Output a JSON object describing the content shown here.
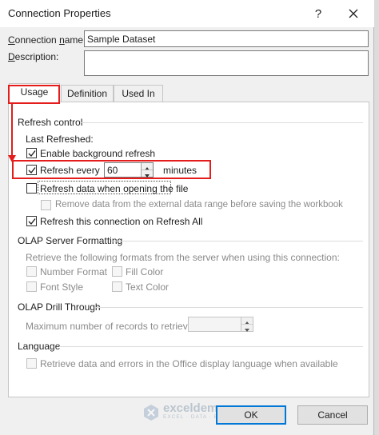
{
  "window": {
    "title": "Connection Properties"
  },
  "connection": {
    "name_label": "Connection name:",
    "name_value": "Sample Dataset",
    "description_label": "Description:",
    "description_value": ""
  },
  "tabs": [
    {
      "label": "Usage"
    },
    {
      "label": "Definition"
    },
    {
      "label": "Used In"
    }
  ],
  "refresh_control": {
    "heading": "Refresh control",
    "last_refreshed_label": "Last Refreshed:",
    "enable_background": {
      "label": "Enable background refresh",
      "checked": true
    },
    "refresh_every": {
      "label": "Refresh every",
      "value": "60",
      "unit": "minutes",
      "checked": true
    },
    "refresh_on_open": {
      "label": "Refresh data when opening the file",
      "checked": false
    },
    "remove_data": {
      "label": "Remove data from the external data range before saving the workbook",
      "checked": false
    },
    "refresh_all": {
      "label": "Refresh this connection on Refresh All",
      "checked": true
    }
  },
  "olap_formatting": {
    "heading": "OLAP Server Formatting",
    "description": "Retrieve the following formats from the server when using this connection:",
    "number_format": "Number Format",
    "fill_color": "Fill Color",
    "font_style": "Font Style",
    "text_color": "Text Color"
  },
  "olap_drill": {
    "heading": "OLAP Drill Through",
    "max_records_label": "Maximum number of records to retrieve:",
    "max_records_value": ""
  },
  "language": {
    "heading": "Language",
    "retrieve_label": "Retrieve data and errors in the Office display language when available"
  },
  "buttons": {
    "ok": "OK",
    "cancel": "Cancel"
  },
  "watermark": {
    "brand": "exceldemy",
    "tagline": "EXCEL · DATA · BI"
  },
  "colors": {
    "highlight": "#e41c1c",
    "focus": "#0078d7"
  }
}
